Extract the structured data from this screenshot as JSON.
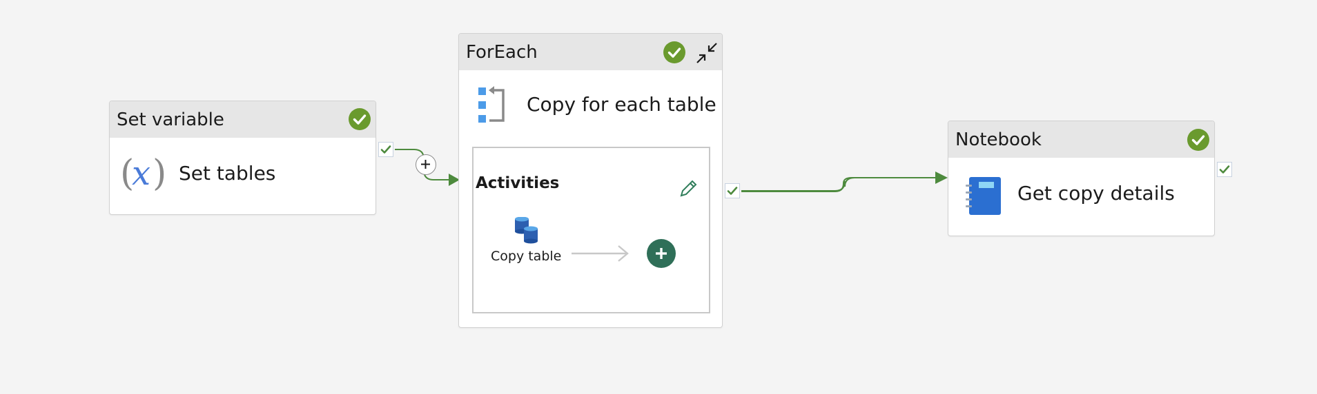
{
  "colors": {
    "canvas": "#f4f4f4",
    "success_green": "#6a9a2e",
    "wire_green": "#4d8a3d",
    "add_activity_green": "#2f6f58",
    "notebook_blue": "#2b6fd1",
    "variable_blue": "#4a7bd8"
  },
  "set_variable": {
    "header": "Set variable",
    "label": "Set tables",
    "icon": "variable-x-icon",
    "status": "succeeded"
  },
  "foreach": {
    "header": "ForEach",
    "label": "Copy for each table",
    "icon": "foreach-icon",
    "status": "succeeded",
    "activities": {
      "title": "Activities",
      "items": [
        {
          "label": "Copy table",
          "icon": "copy-data-icon"
        }
      ]
    }
  },
  "notebook": {
    "header": "Notebook",
    "label": "Get copy details",
    "icon": "notebook-icon",
    "status": "succeeded"
  }
}
